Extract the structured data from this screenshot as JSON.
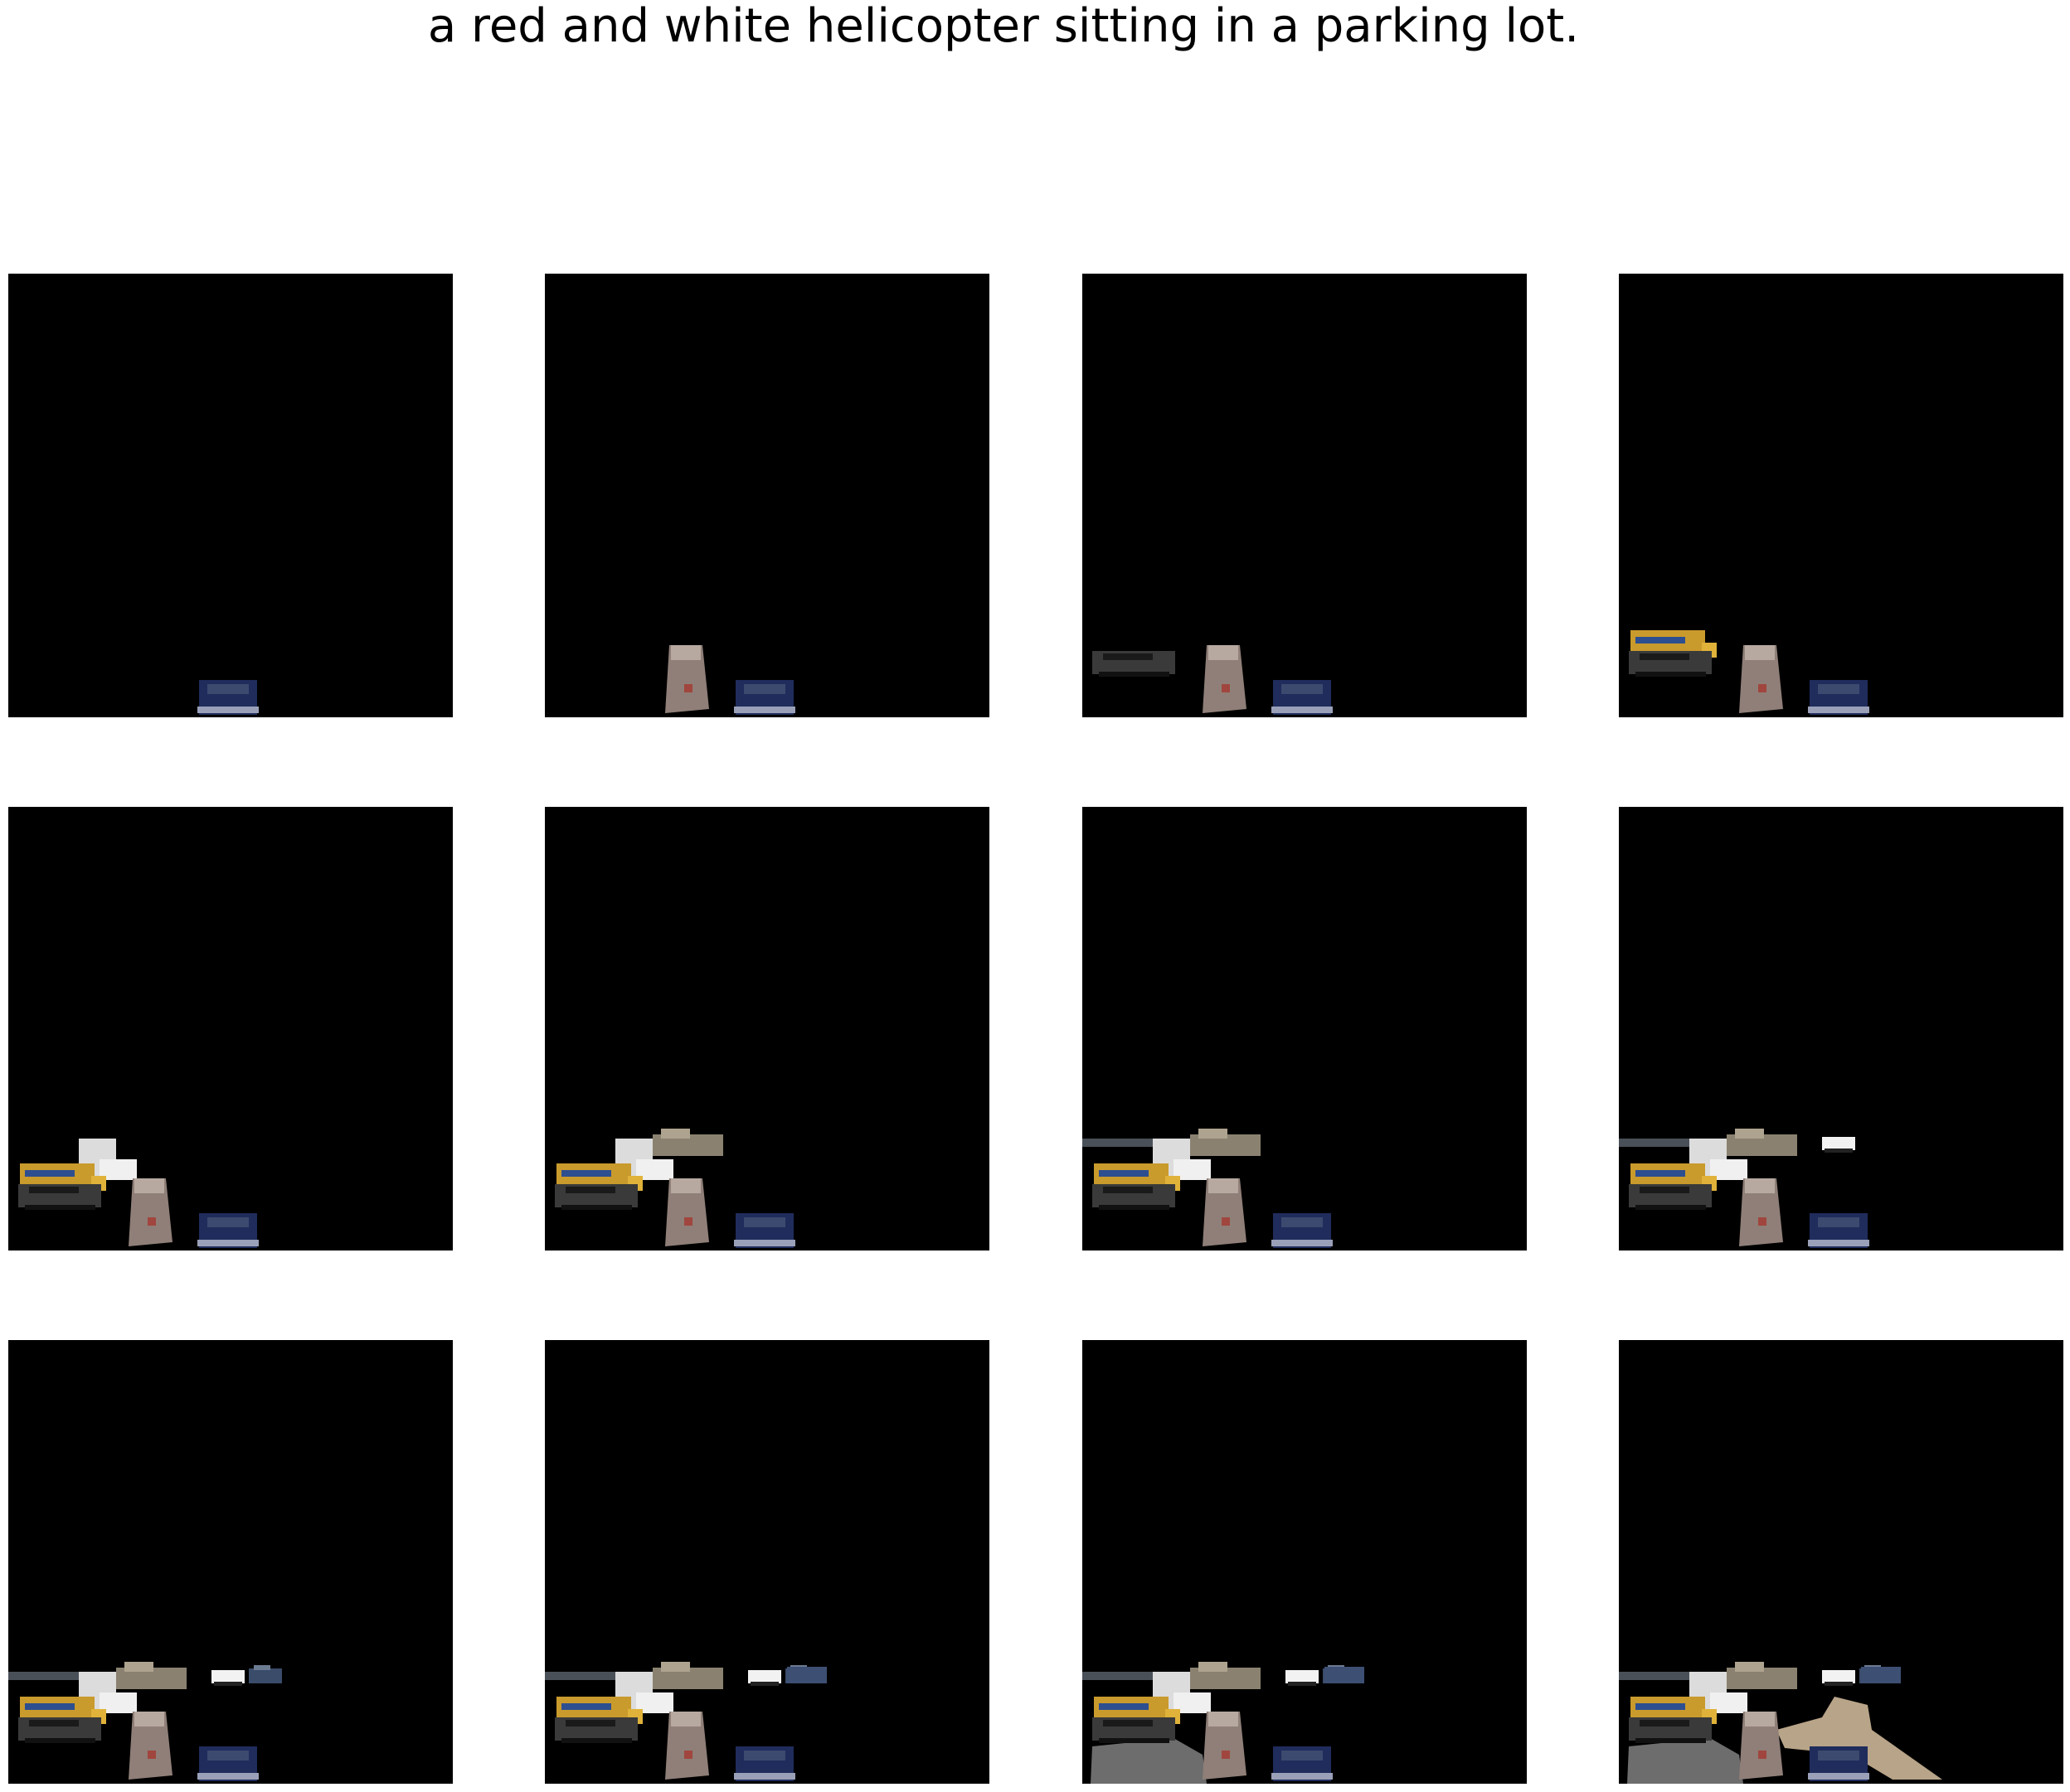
{
  "figure": {
    "caption": "a red and white helicopter sitting in a parking lot.",
    "rows": 3,
    "cols": 4,
    "background": "#000000"
  },
  "panels": [
    {
      "step": 1,
      "objects": [
        "blue-car"
      ]
    },
    {
      "step": 2,
      "objects": [
        "blue-car",
        "rubble-block"
      ]
    },
    {
      "step": 3,
      "objects": [
        "blue-car",
        "rubble-block",
        "dark-van"
      ]
    },
    {
      "step": 4,
      "objects": [
        "blue-car",
        "rubble-block",
        "dark-van",
        "yellow-truck"
      ]
    },
    {
      "step": 5,
      "objects": [
        "blue-car",
        "rubble-block",
        "dark-van",
        "yellow-truck",
        "white-truck"
      ]
    },
    {
      "step": 6,
      "objects": [
        "blue-car",
        "rubble-block",
        "dark-van",
        "yellow-truck",
        "white-truck",
        "pickup"
      ]
    },
    {
      "step": 7,
      "objects": [
        "blue-car",
        "rubble-block",
        "dark-van",
        "yellow-truck",
        "white-truck",
        "pickup",
        "road-strip"
      ]
    },
    {
      "step": 8,
      "objects": [
        "blue-car",
        "rubble-block",
        "dark-van",
        "yellow-truck",
        "white-truck",
        "pickup",
        "road-strip",
        "white-car"
      ]
    },
    {
      "step": 9,
      "objects": [
        "blue-car",
        "rubble-block",
        "dark-van",
        "yellow-truck",
        "white-truck",
        "pickup",
        "road-strip",
        "white-car",
        "small-blue-vehicle"
      ]
    },
    {
      "step": 10,
      "objects": [
        "blue-car",
        "rubble-block",
        "dark-van",
        "yellow-truck",
        "white-truck",
        "pickup",
        "road-strip",
        "white-car",
        "small-blue-vehicle",
        "blue-vehicle-2"
      ]
    },
    {
      "step": 11,
      "objects": [
        "blue-car",
        "rubble-block",
        "dark-van",
        "yellow-truck",
        "white-truck",
        "pickup",
        "road-strip",
        "white-car",
        "small-blue-vehicle",
        "blue-vehicle-2",
        "gravel-ground"
      ]
    },
    {
      "step": 12,
      "objects": [
        "blue-car",
        "rubble-block",
        "dark-van",
        "yellow-truck",
        "white-truck",
        "pickup",
        "road-strip",
        "white-car",
        "small-blue-vehicle",
        "blue-vehicle-2",
        "gravel-ground",
        "tan-surface"
      ]
    }
  ],
  "colors": {
    "blue_car": "#1f2c5c",
    "rubble": "#8f7f78",
    "dark_van": "#3a3a3a",
    "yellow_truck": "#c99a2c",
    "white_truck": "#dcdcdc",
    "pickup": "#8a8170",
    "road": "#4a5058",
    "gravel": "#6d6d6d",
    "tan": "#b8a488"
  }
}
